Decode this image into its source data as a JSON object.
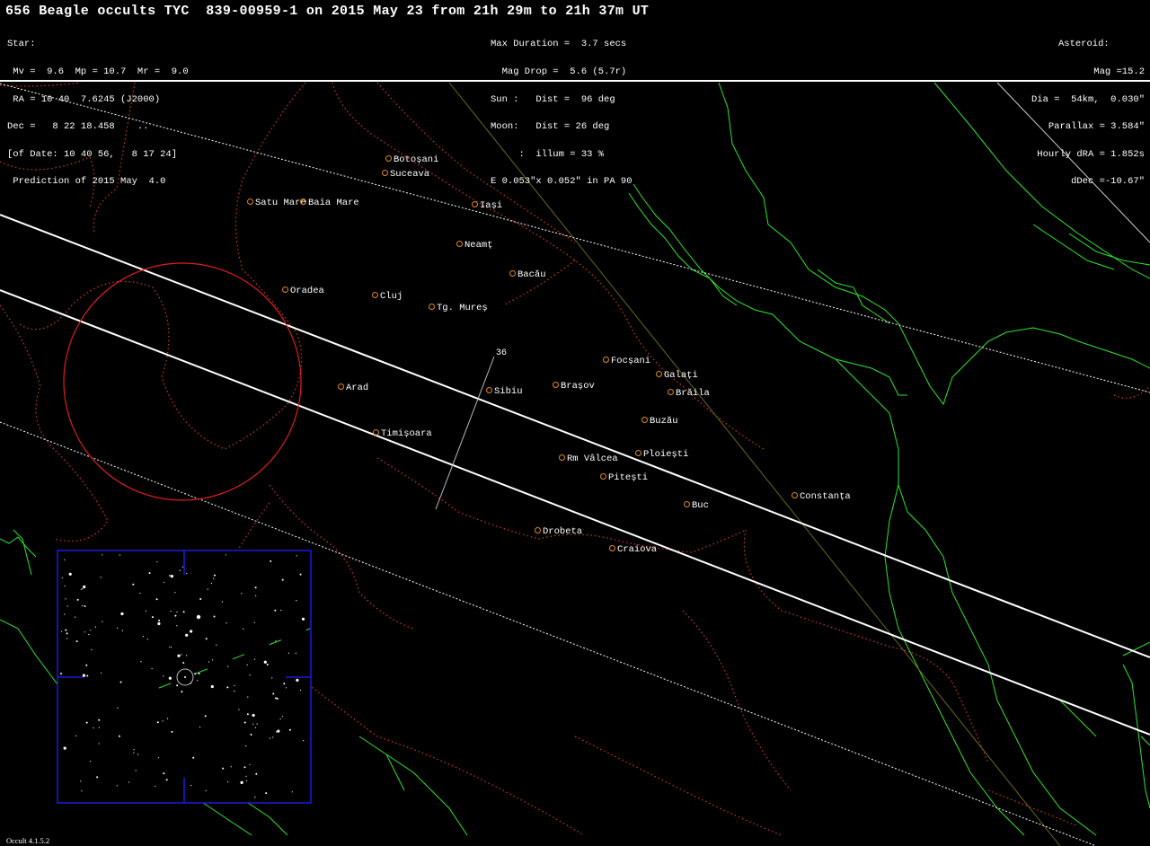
{
  "title": "656 Beagle occults TYC  839-00959-1 on 2015 May 23 from 21h 29m to 21h 37m UT",
  "star_block": [
    "Star:",
    " Mv =  9.6  Mp = 10.7  Mr =  9.0",
    " RA = 10 40  7.6245 (J2000)",
    "Dec =   8 22 18.458    ..",
    "[of Date: 10 40 56,   8 17 24]",
    " Prediction of 2015 May  4.0"
  ],
  "event_block": [
    "Max Duration =  3.7 secs",
    "  Mag Drop =  5.6 (5.7r)",
    "Sun :   Dist =  96 deg",
    "Moon:   Dist = 26 deg",
    "     :  illum = 33 %",
    "E 0.053\"x 0.052\" in PA 90"
  ],
  "asteroid_block": [
    "Asteroid:",
    "Mag =15.2",
    "Dia =  54km,  0.030\"",
    "Parallax = 3.584\"",
    "Hourly dRA = 1.852s",
    "dDec =-10.67\""
  ],
  "time_marker": "36",
  "cities": [
    {
      "name": "Botoșani"
    },
    {
      "name": "Suceava"
    },
    {
      "name": "Satu Mare"
    },
    {
      "name": "Baia Mare"
    },
    {
      "name": "Iași"
    },
    {
      "name": "Neamț"
    },
    {
      "name": "Bacău"
    },
    {
      "name": "Oradea"
    },
    {
      "name": "Cluj"
    },
    {
      "name": "Tg. Mureș"
    },
    {
      "name": "Arad"
    },
    {
      "name": "Sibiu"
    },
    {
      "name": "Brașov"
    },
    {
      "name": "Focșani"
    },
    {
      "name": "Galați"
    },
    {
      "name": "Brăila"
    },
    {
      "name": "Buzău"
    },
    {
      "name": "Timișoara"
    },
    {
      "name": "Ploiești"
    },
    {
      "name": "Rm Vâlcea"
    },
    {
      "name": "Pitești"
    },
    {
      "name": "Constanța"
    },
    {
      "name": "Buc"
    },
    {
      "name": "Drobeta"
    },
    {
      "name": "Craiova"
    }
  ],
  "footer": "Occult 4.1.5.2",
  "colors": {
    "background": "#000000",
    "path_line": "#ffffff",
    "border": "#d03a2a",
    "coast": "#2ee52e",
    "city_marker": "#e08a1e",
    "starfield_frame": "#1a1add",
    "circle": "#e01e1e"
  }
}
